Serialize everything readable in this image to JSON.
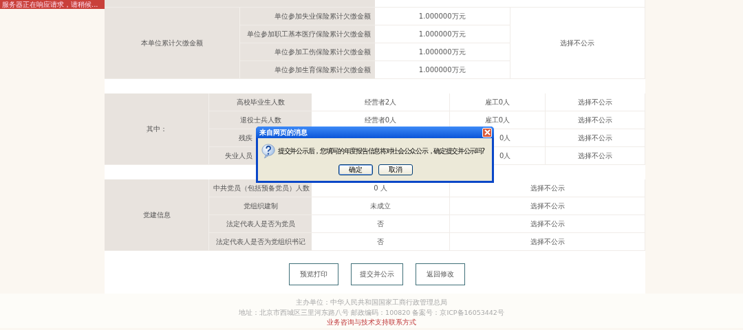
{
  "toast": {
    "text": "服务器正在响应请求，请稍候..."
  },
  "arrears": {
    "group": "本单位累计欠缴金额",
    "public": "选择不公示",
    "rows": [
      {
        "label": "单位参加失业保险累计欠缴金额",
        "value": "1.000000万元"
      },
      {
        "label": "单位参加职工基本医疗保险累计欠缴金额",
        "value": "1.000000万元"
      },
      {
        "label": "单位参加工伤保险累计欠缴金额",
        "value": "1.000000万元"
      },
      {
        "label": "单位参加生育保险累计欠缴金额",
        "value": "1.000000万元"
      }
    ]
  },
  "employment": {
    "group": "其中：",
    "rows": [
      {
        "label": "高校毕业生人数",
        "operators": "经营者2人",
        "employees": "雇工0人",
        "public": "选择不公示"
      },
      {
        "label": "退役士兵人数",
        "operators": "经营者0人",
        "employees": "雇工0人",
        "public": "选择不公示"
      },
      {
        "label": "残疾",
        "employees": "0人",
        "public": "选择不公示"
      },
      {
        "label": "失业人员",
        "employees": "0人",
        "public": "选择不公示"
      }
    ]
  },
  "party": {
    "group": "党建信息",
    "rows": [
      {
        "label": "中共党员（包括预备党员）人数",
        "value": "0 人",
        "public": "选择不公示"
      },
      {
        "label": "党组织建制",
        "value": "未成立",
        "public": "选择不公示"
      },
      {
        "label": "法定代表人是否为党员",
        "value": "否",
        "public": "选择不公示"
      },
      {
        "label": "法定代表人是否为党组织书记",
        "value": "否",
        "public": "选择不公示"
      }
    ]
  },
  "buttons": [
    "预览打印",
    "提交并公示",
    "返回修改"
  ],
  "dialog": {
    "title": "来自网页的消息",
    "message": "提交并公示后，您填写的年度报告信息将对社会公众公示，确定提交并公示吗?",
    "buttons": [
      {
        "label": "确定",
        "focused": true
      },
      {
        "label": "取消",
        "focused": false
      }
    ]
  },
  "footer": {
    "lines": [
      "主办单位：中华人民共和国国家工商行政管理总局",
      "地址：北京市西城区三里河东路八号 邮政编码：100820 备案号：京ICP备16053442号"
    ],
    "link": "业务咨询与技术支持联系方式"
  }
}
